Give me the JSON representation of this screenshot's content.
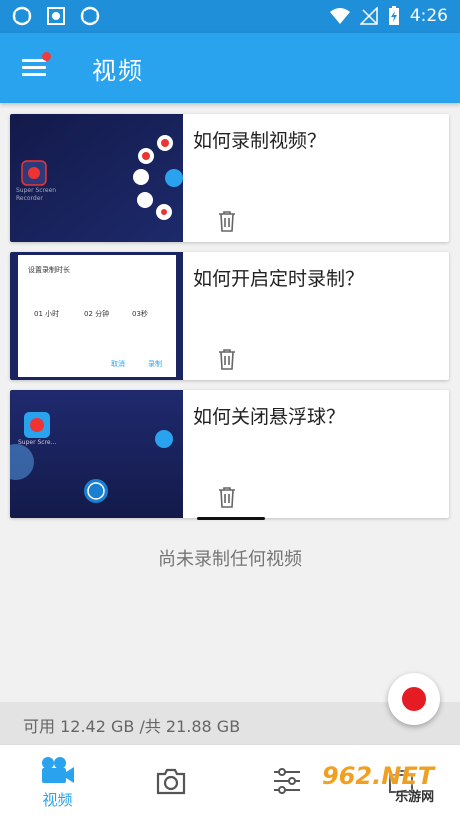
{
  "status": {
    "time": "4:26"
  },
  "appbar": {
    "title": "视频"
  },
  "videos": [
    {
      "title": "如何录制视频？",
      "thumb_caption": "Super Screen Recorder"
    },
    {
      "title": "如何开启定时录制？",
      "dialog": {
        "title": "设置录制时长",
        "hours": "01",
        "hours_unit": "小时",
        "minutes": "02",
        "minutes_unit": "分钟",
        "seconds": "03秒",
        "cancel": "取消",
        "confirm": "录制"
      }
    },
    {
      "title": "如何关闭悬浮球？",
      "thumb_caption": "Super Scre..."
    }
  ],
  "empty_message": "尚未录制任何视频",
  "storage": {
    "text": "可用 12.42 GB /共 21.88 GB"
  },
  "bottom_nav": [
    {
      "label": "视频",
      "icon": "video-camera-icon",
      "active": true
    },
    {
      "label": "",
      "icon": "camera-icon"
    },
    {
      "label": "",
      "icon": "sliders-icon"
    },
    {
      "label": "",
      "icon": "toolbox-icon"
    }
  ],
  "watermark": {
    "text": "962",
    "sub": "乐游网"
  },
  "colors": {
    "primary": "#2aa3ef",
    "status_bar": "#1e8fd8",
    "record": "#e51c23"
  }
}
